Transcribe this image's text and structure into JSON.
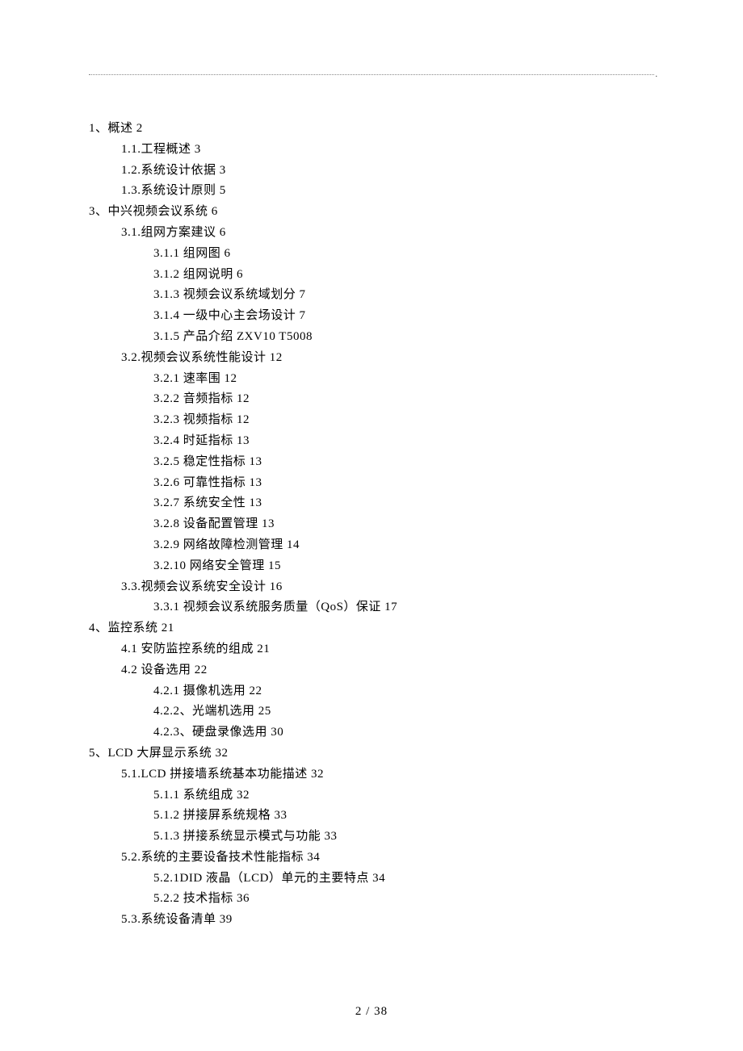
{
  "footer": "2 / 38",
  "toc": [
    {
      "level": 0,
      "text": "1、概述 2"
    },
    {
      "level": 1,
      "text": "1.1.工程概述 3"
    },
    {
      "level": 1,
      "text": "1.2.系统设计依据 3"
    },
    {
      "level": 1,
      "text": "1.3.系统设计原则 5"
    },
    {
      "level": 0,
      "text": "3、中兴视频会议系统 6"
    },
    {
      "level": 1,
      "text": "3.1.组网方案建议 6"
    },
    {
      "level": 2,
      "text": "3.1.1 组网图 6"
    },
    {
      "level": 2,
      "text": "3.1.2 组网说明 6"
    },
    {
      "level": 2,
      "text": "3.1.3 视频会议系统域划分 7"
    },
    {
      "level": 2,
      "text": "3.1.4 一级中心主会场设计 7"
    },
    {
      "level": 2,
      "text": "3.1.5 产品介绍 ZXV10 T5008"
    },
    {
      "level": 1,
      "text": "3.2.视频会议系统性能设计 12"
    },
    {
      "level": 2,
      "text": "3.2.1 速率围 12"
    },
    {
      "level": 2,
      "text": "3.2.2 音频指标 12"
    },
    {
      "level": 2,
      "text": "3.2.3 视频指标 12"
    },
    {
      "level": 2,
      "text": "3.2.4 时延指标 13"
    },
    {
      "level": 2,
      "text": "3.2.5 稳定性指标 13"
    },
    {
      "level": 2,
      "text": "3.2.6 可靠性指标 13"
    },
    {
      "level": 2,
      "text": "3.2.7 系统安全性 13"
    },
    {
      "level": 2,
      "text": "3.2.8 设备配置管理 13"
    },
    {
      "level": 2,
      "text": "3.2.9 网络故障检测管理 14"
    },
    {
      "level": 2,
      "text": "3.2.10 网络安全管理 15"
    },
    {
      "level": 1,
      "text": "3.3.视频会议系统安全设计 16"
    },
    {
      "level": 2,
      "text": "3.3.1 视频会议系统服务质量（QoS）保证 17"
    },
    {
      "level": 0,
      "text": "4、监控系统 21"
    },
    {
      "level": 1,
      "text": "4.1 安防监控系统的组成 21"
    },
    {
      "level": 1,
      "text": "4.2 设备选用 22"
    },
    {
      "level": 2,
      "text": "4.2.1 摄像机选用 22"
    },
    {
      "level": 2,
      "text": "4.2.2、光端机选用 25"
    },
    {
      "level": 2,
      "text": "4.2.3、硬盘录像选用 30"
    },
    {
      "level": 0,
      "text": "5、LCD 大屏显示系统 32"
    },
    {
      "level": 1,
      "text": "5.1.LCD 拼接墙系统基本功能描述 32"
    },
    {
      "level": 2,
      "text": "5.1.1 系统组成 32"
    },
    {
      "level": 2,
      "text": "5.1.2 拼接屏系统规格 33"
    },
    {
      "level": 2,
      "text": "5.1.3 拼接系统显示模式与功能 33"
    },
    {
      "level": 1,
      "text": "5.2.系统的主要设备技术性能指标 34"
    },
    {
      "level": 2,
      "text": "5.2.1DID 液晶（LCD）单元的主要特点 34"
    },
    {
      "level": 2,
      "text": "5.2.2 技术指标 36"
    },
    {
      "level": 1,
      "text": "5.3.系统设备清单 39"
    }
  ]
}
